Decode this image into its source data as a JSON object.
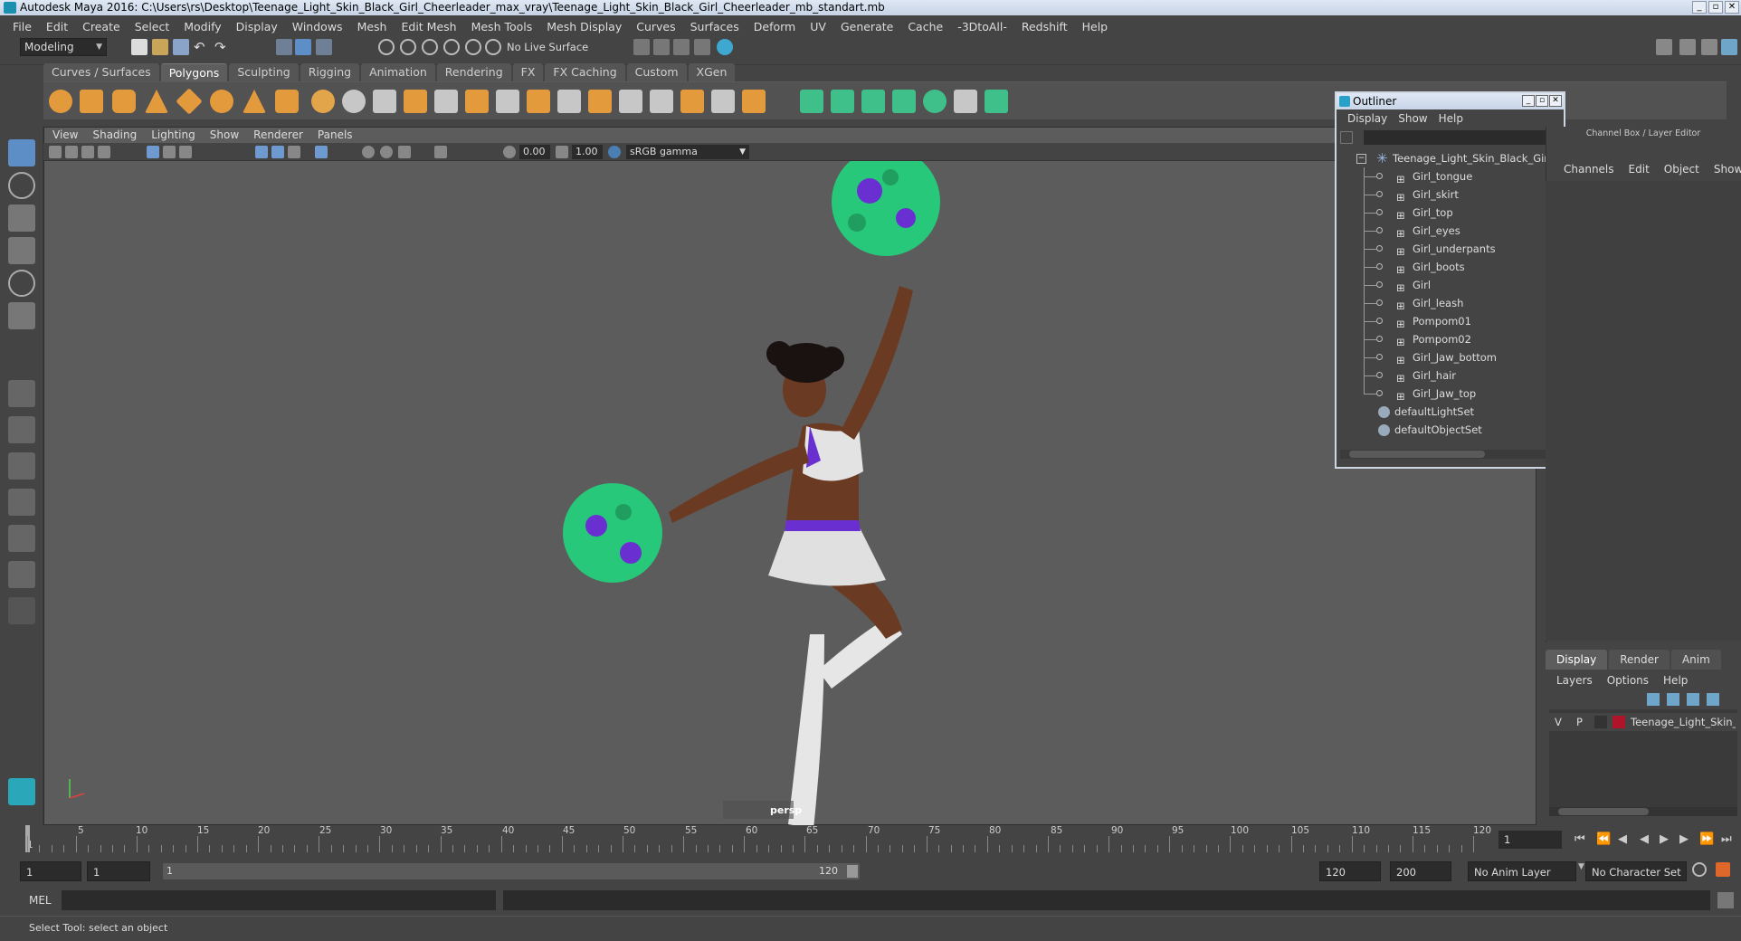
{
  "titlebar": {
    "title": "Autodesk Maya 2016: C:\\Users\\rs\\Desktop\\Teenage_Light_Skin_Black_Girl_Cheerleader_max_vray\\Teenage_Light_Skin_Black_Girl_Cheerleader_mb_standart.mb",
    "min": "_",
    "max": "▫",
    "close": "✕"
  },
  "menubar": [
    "File",
    "Edit",
    "Create",
    "Select",
    "Modify",
    "Display",
    "Windows",
    "Mesh",
    "Edit Mesh",
    "Mesh Tools",
    "Mesh Display",
    "Curves",
    "Surfaces",
    "Deform",
    "UV",
    "Generate",
    "Cache",
    "-3DtoAll-",
    "Redshift",
    "Help"
  ],
  "statusline": {
    "mode": "Modeling",
    "live_surface": "No Live Surface"
  },
  "shelf": {
    "tabs": [
      "Curves / Surfaces",
      "Polygons",
      "Sculpting",
      "Rigging",
      "Animation",
      "Rendering",
      "FX",
      "FX Caching",
      "Custom",
      "XGen"
    ],
    "active_tab": "Polygons"
  },
  "viewport": {
    "menu": [
      "View",
      "Shading",
      "Lighting",
      "Show",
      "Renderer",
      "Panels"
    ],
    "exposure": "0.00",
    "gamma": "1.00",
    "colorspace": "sRGB gamma",
    "camera_label": "persp"
  },
  "outliner": {
    "title": "Outliner",
    "menu": [
      "Display",
      "Show",
      "Help"
    ],
    "root": "Teenage_Light_Skin_Black_Girl_Cl",
    "children": [
      "Girl_tongue",
      "Girl_skirt",
      "Girl_top",
      "Girl_eyes",
      "Girl_underpants",
      "Girl_boots",
      "Girl",
      "Girl_leash",
      "Pompom01",
      "Pompom02",
      "Girl_Jaw_bottom",
      "Girl_hair",
      "Girl_Jaw_top"
    ],
    "sets": [
      "defaultLightSet",
      "defaultObjectSet"
    ]
  },
  "channelbox": {
    "title": "Channel Box / Layer Editor",
    "menu": [
      "Channels",
      "Edit",
      "Object",
      "Show"
    ],
    "layer_tabs": [
      "Display",
      "Render",
      "Anim"
    ],
    "active_layer_tab": "Display",
    "layer_menu": [
      "Layers",
      "Options",
      "Help"
    ],
    "layer": {
      "v": "V",
      "p": "P",
      "name": "Teenage_Light_Skin_Bl",
      "color": "#b0142a"
    }
  },
  "timeline": {
    "ticks": [
      "1",
      "5",
      "10",
      "15",
      "20",
      "25",
      "30",
      "35",
      "40",
      "45",
      "50",
      "55",
      "60",
      "65",
      "70",
      "75",
      "80",
      "85",
      "90",
      "95",
      "100",
      "105",
      "110",
      "115",
      "120"
    ],
    "current_frame": "1"
  },
  "range": {
    "start": "1",
    "inner_start": "1",
    "slider_start": "1",
    "slider_end": "120",
    "end": "120",
    "max": "200",
    "anim_layer": "No Anim Layer",
    "char_set": "No Character Set"
  },
  "cmdline": {
    "label": "MEL"
  },
  "helpline": {
    "text": "Select Tool: select an object"
  },
  "colors": {
    "accent": "#5d8fc6",
    "pompom_green": "#27c87a",
    "pompom_purple": "#6a2fd1"
  }
}
